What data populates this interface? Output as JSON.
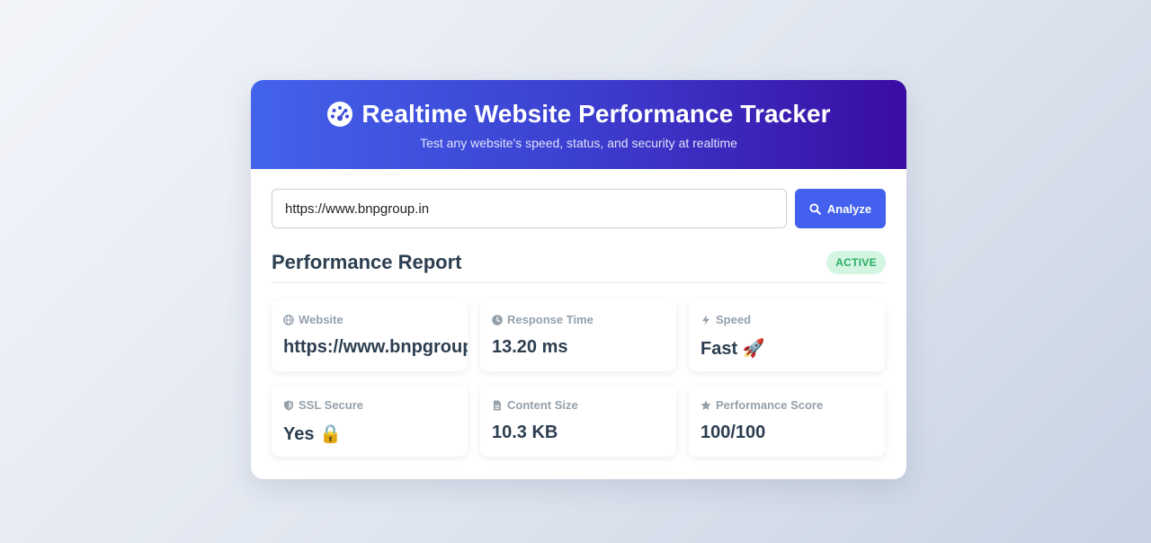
{
  "header": {
    "icon": "gauge-icon",
    "title": "Realtime Website Performance Tracker",
    "subtitle": "Test any website's speed, status, and security at realtime"
  },
  "search": {
    "value": "https://www.bnpgroup.in",
    "button_label": "Analyze",
    "button_icon": "search-icon"
  },
  "report": {
    "title": "Performance Report",
    "status": "ACTIVE",
    "metrics": [
      {
        "label": "Website",
        "icon": "globe-icon",
        "value": "https://www.bnpgroup.in"
      },
      {
        "label": "Response Time",
        "icon": "clock-icon",
        "value": "13.20 ms"
      },
      {
        "label": "Speed",
        "icon": "bolt-icon",
        "value": "Fast 🚀"
      },
      {
        "label": "SSL Secure",
        "icon": "shield-icon",
        "value": "Yes 🔒"
      },
      {
        "label": "Content Size",
        "icon": "file-icon",
        "value": "10.3 KB"
      },
      {
        "label": "Performance Score",
        "icon": "star-icon",
        "value": "100/100"
      }
    ]
  },
  "colors": {
    "accent": "#4361ee",
    "header_gradient_end": "#3a0ca3",
    "active_badge_bg": "#d5f5e3",
    "active_badge_text": "#27ae60",
    "text_dark": "#2c3e50",
    "label_gray": "#95a0ab"
  }
}
